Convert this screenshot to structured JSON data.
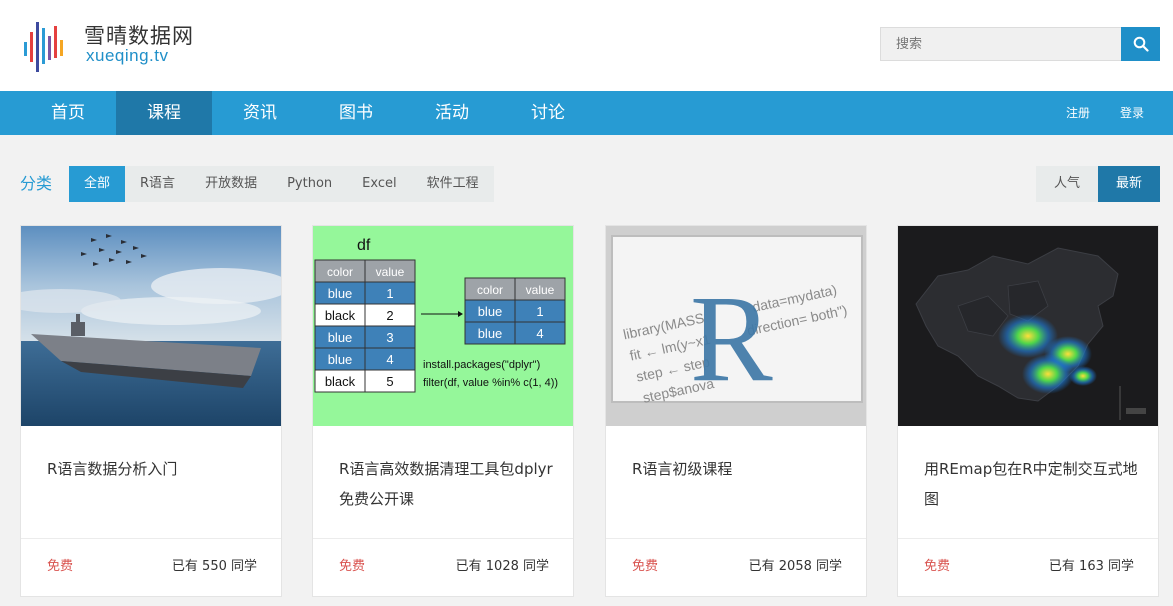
{
  "brand": {
    "name_cn": "雪晴数据网",
    "name_en": "xueqing.tv",
    "accent": "#279bd3"
  },
  "search": {
    "placeholder": "搜索",
    "icon": "search-icon"
  },
  "nav": {
    "items": [
      {
        "label": "首页"
      },
      {
        "label": "课程",
        "active": true
      },
      {
        "label": "资讯"
      },
      {
        "label": "图书"
      },
      {
        "label": "活动"
      },
      {
        "label": "讨论"
      }
    ],
    "register": "注册",
    "login": "登录"
  },
  "filter": {
    "label": "分类",
    "tabs": [
      {
        "label": "全部",
        "active": true
      },
      {
        "label": "R语言"
      },
      {
        "label": "开放数据"
      },
      {
        "label": "Python"
      },
      {
        "label": "Excel"
      },
      {
        "label": "软件工程"
      }
    ],
    "sort": [
      {
        "label": "人气"
      },
      {
        "label": "最新",
        "active": true
      }
    ]
  },
  "courses": [
    {
      "title": "R语言数据分析入门",
      "price": "免费",
      "students": "已有 550 同学"
    },
    {
      "title": "R语言高效数据清理工具包dplyr免费公开课",
      "price": "免费",
      "students": "已有 1028 同学"
    },
    {
      "title": "R语言初级课程",
      "price": "免费",
      "students": "已有 2058 同学"
    },
    {
      "title": "用REmap包在R中定制交互式地图",
      "price": "免费",
      "students": "已有 163 同学"
    }
  ],
  "thumb_dplyr": {
    "df_label": "df",
    "col_color": "color",
    "col_value": "value",
    "rows": [
      {
        "color": "blue",
        "value": "1"
      },
      {
        "color": "black",
        "value": "2"
      },
      {
        "color": "blue",
        "value": "3"
      },
      {
        "color": "blue",
        "value": "4"
      },
      {
        "color": "black",
        "value": "5"
      }
    ],
    "result_rows": [
      {
        "color": "blue",
        "value": "1"
      },
      {
        "color": "blue",
        "value": "4"
      }
    ],
    "code1": "install.packages(\"dplyr\")",
    "code2": "filter(df, value %in% c(1, 4))"
  },
  "thumb_r": {
    "letter": "R",
    "line1": "library(MASS",
    "line1b": "data=mydata)",
    "line2": "fit ← lm(y~x1",
    "line2b": "direction= both\")",
    "line3": "step ← step",
    "line4": "step$anova"
  }
}
